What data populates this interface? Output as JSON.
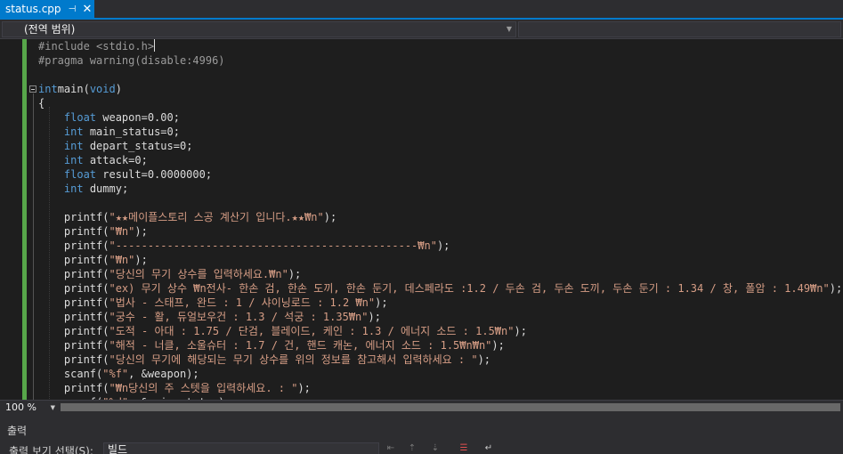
{
  "tab": {
    "filename": "status.cpp",
    "pin_glyph": "⊣",
    "close_glyph": "✕"
  },
  "navbar": {
    "scope": "(전역 범위)"
  },
  "editor": {
    "lines": [
      [
        [
          "pp",
          "#include <stdio.h>"
        ]
      ],
      [
        [
          "pp",
          "#pragma warning(disable:4996)"
        ]
      ],
      [],
      [
        [
          "kw",
          "int"
        ],
        [
          "",
          "main("
        ],
        [
          "kw",
          "void"
        ],
        [
          "",
          ")"
        ]
      ],
      [
        [
          "",
          "{"
        ]
      ],
      [
        [
          "",
          "    "
        ],
        [
          "kw",
          "float"
        ],
        [
          "",
          " weapon=0.00;"
        ]
      ],
      [
        [
          "",
          "    "
        ],
        [
          "kw",
          "int"
        ],
        [
          "",
          " main_status=0;"
        ]
      ],
      [
        [
          "",
          "    "
        ],
        [
          "kw",
          "int"
        ],
        [
          "",
          " depart_status=0;"
        ]
      ],
      [
        [
          "",
          "    "
        ],
        [
          "kw",
          "int"
        ],
        [
          "",
          " attack=0;"
        ]
      ],
      [
        [
          "",
          "    "
        ],
        [
          "kw",
          "float"
        ],
        [
          "",
          " result=0.0000000;"
        ]
      ],
      [
        [
          "",
          "    "
        ],
        [
          "kw",
          "int"
        ],
        [
          "",
          " dummy;"
        ]
      ],
      [],
      [
        [
          "",
          "    printf("
        ],
        [
          "str",
          "\"★★메이플스토리 스공 계산기 입니다.★★₩n\""
        ],
        [
          "",
          ");"
        ]
      ],
      [
        [
          "",
          "    printf("
        ],
        [
          "str",
          "\"₩n\""
        ],
        [
          "",
          ");"
        ]
      ],
      [
        [
          "",
          "    printf("
        ],
        [
          "str",
          "\"-----------------------------------------------₩n\""
        ],
        [
          "",
          ");"
        ]
      ],
      [
        [
          "",
          "    printf("
        ],
        [
          "str",
          "\"₩n\""
        ],
        [
          "",
          ");"
        ]
      ],
      [
        [
          "",
          "    printf("
        ],
        [
          "str",
          "\"당신의 무기 상수를 입력하세요.₩n\""
        ],
        [
          "",
          ");"
        ]
      ],
      [
        [
          "",
          "    printf("
        ],
        [
          "str",
          "\"ex) 무기 상수 ₩n전사- 한손 검, 한손 도끼, 한손 둔기, 데스페라도 :1.2 / 두손 검, 두손 도끼, 두손 둔기 : 1.34 / 창, 폴암 : 1.49₩n\""
        ],
        [
          "",
          ");"
        ]
      ],
      [
        [
          "",
          "    printf("
        ],
        [
          "str",
          "\"법사 - 스태프, 완드 : 1 / 샤이닝로드 : 1.2 ₩n\""
        ],
        [
          "",
          ");"
        ]
      ],
      [
        [
          "",
          "    printf("
        ],
        [
          "str",
          "\"궁수 - 활, 듀얼보우건 : 1.3 / 석궁 : 1.35₩n\""
        ],
        [
          "",
          ");"
        ]
      ],
      [
        [
          "",
          "    printf("
        ],
        [
          "str",
          "\"도적 - 아대 : 1.75 / 단검, 블레이드, 케인 : 1.3 / 에너지 소드 : 1.5₩n\""
        ],
        [
          "",
          ");"
        ]
      ],
      [
        [
          "",
          "    printf("
        ],
        [
          "str",
          "\"해적 - 너클, 소울슈터 : 1.7 / 건, 핸드 캐논, 에너지 소드 : 1.5₩n₩n\""
        ],
        [
          "",
          ");"
        ]
      ],
      [
        [
          "",
          "    printf("
        ],
        [
          "str",
          "\"당신의 무기에 해당되는 무기 상수를 위의 정보를 참고해서 입력하세요 : \""
        ],
        [
          "",
          ");"
        ]
      ],
      [
        [
          "",
          "    scanf("
        ],
        [
          "str",
          "\"%f\""
        ],
        [
          "",
          ", &weapon);"
        ]
      ],
      [
        [
          "",
          "    printf("
        ],
        [
          "str",
          "\"₩n당신의 주 스텟을 입력하세요. : \""
        ],
        [
          "",
          ");"
        ]
      ],
      [
        [
          "",
          "    scanf("
        ],
        [
          "str",
          "\"%d\""
        ],
        [
          "",
          ", &main_status);"
        ]
      ]
    ]
  },
  "zoom": {
    "value": "100 %"
  },
  "output": {
    "title": "출력",
    "show_label": "출력 보기 선택(S):",
    "selected": "빌드"
  }
}
